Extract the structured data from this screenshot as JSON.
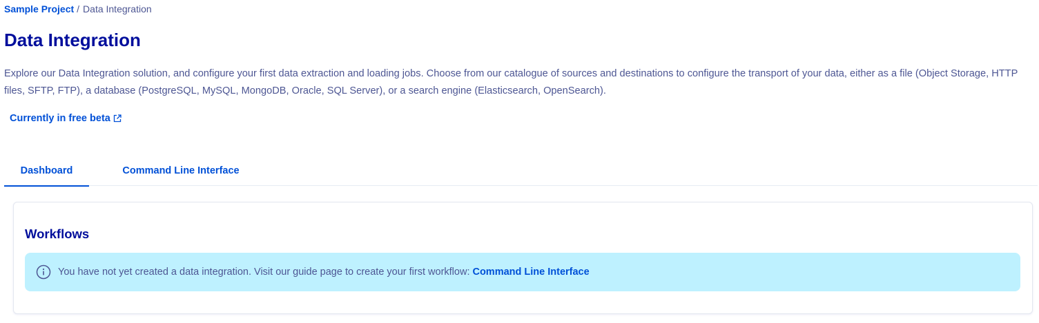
{
  "breadcrumb": {
    "project": "Sample Project",
    "separator": "/",
    "current": "Data Integration"
  },
  "page_title": "Data Integration",
  "description": "Explore our Data Integration solution, and configure your first data extraction and loading jobs. Choose from our catalogue of sources and destinations to configure the transport of your data, either as a file (Object Storage, HTTP files, SFTP, FTP), a database (PostgreSQL, MySQL, MongoDB, Oracle, SQL Server), or a search engine (Elasticsearch, OpenSearch).",
  "beta_link": {
    "label": "Currently in free beta",
    "icon": "external-link-icon"
  },
  "tabs": [
    {
      "label": "Dashboard",
      "active": true
    },
    {
      "label": "Command Line Interface",
      "active": false
    }
  ],
  "workflows": {
    "title": "Workflows",
    "info": {
      "icon": "info-circle-icon",
      "message": "You have not yet created a data integration. Visit our guide page to create your first workflow:",
      "link_label": "Command Line Interface"
    }
  },
  "colors": {
    "primary_link": "#0050d7",
    "heading": "#000e9c",
    "body_text": "#4d5693",
    "info_background": "#bef1ff"
  }
}
